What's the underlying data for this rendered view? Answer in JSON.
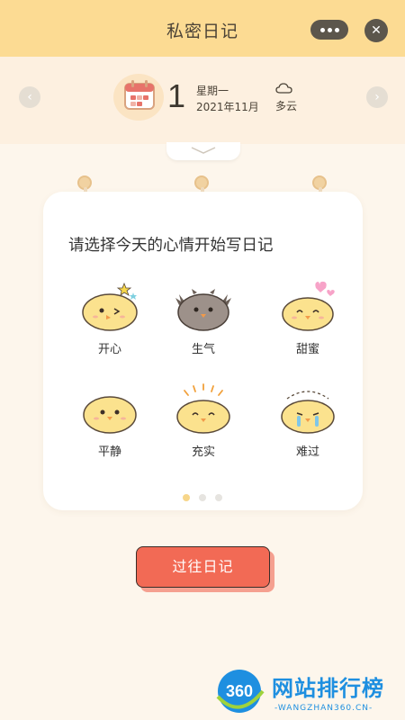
{
  "header": {
    "title": "私密日记",
    "menu_icon": "more-dots-icon",
    "close_icon": "close-icon"
  },
  "date": {
    "day": "1",
    "weekday": "星期一",
    "year_month": "2021年11月",
    "weather": "多云",
    "prev_icon": "chevron-left-icon",
    "next_icon": "chevron-right-icon"
  },
  "card": {
    "prompt": "请选择今天的心情开始写日记",
    "moods": [
      {
        "label": "开心",
        "icon": "happy-chick-icon"
      },
      {
        "label": "生气",
        "icon": "angry-chick-icon"
      },
      {
        "label": "甜蜜",
        "icon": "sweet-chick-icon"
      },
      {
        "label": "平静",
        "icon": "calm-chick-icon"
      },
      {
        "label": "充实",
        "icon": "fulfilled-chick-icon"
      },
      {
        "label": "难过",
        "icon": "sad-chick-icon"
      }
    ],
    "page_index": 1,
    "page_count": 3
  },
  "past_button": {
    "label": "过往日记"
  },
  "watermark": {
    "logo_text": "360",
    "title": "网站排行榜",
    "subtitle": "-WANGZHAN360.CN-"
  },
  "colors": {
    "header_bg": "#fcdb93",
    "accent": "#f26a55",
    "chick_yellow": "#fbe28e",
    "watermark_blue": "#1e8fe0"
  }
}
